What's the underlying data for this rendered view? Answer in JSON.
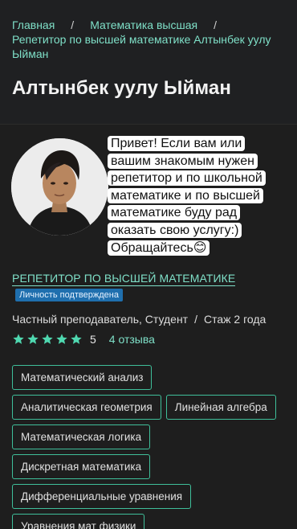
{
  "breadcrumb": {
    "items": [
      "Главная",
      "Математика высшая",
      "Репетитор по высшей математике Алтынбек уулу Ыйман"
    ],
    "separator": "/"
  },
  "profile": {
    "name": "Алтынбек уулу Ыйман",
    "greeting": "Привет! Если вам или вашим знакомым нужен репетитор и по школьной математике и по высшей математике буду рад оказать свою услугу:) Обращайтесь😊",
    "role": "Репетитор по высшей математике",
    "verified_badge": "Личность подтверждена",
    "type": "Частный преподаватель, Студент",
    "experience": "Стаж 2 года",
    "rating": "5",
    "stars": 5,
    "reviews": "4 отзыва"
  },
  "tags": [
    "Математический анализ",
    "Аналитическая геометрия",
    "Линейная алгебра",
    "Математическая логика",
    "Дискретная математика",
    "Дифференциальные уравнения",
    "Уравнения мат физики"
  ],
  "colors": {
    "accent": "#7fe0c8",
    "star": "#4fd8b0",
    "badge": "#1f6fae",
    "background": "#1e1e1e"
  }
}
